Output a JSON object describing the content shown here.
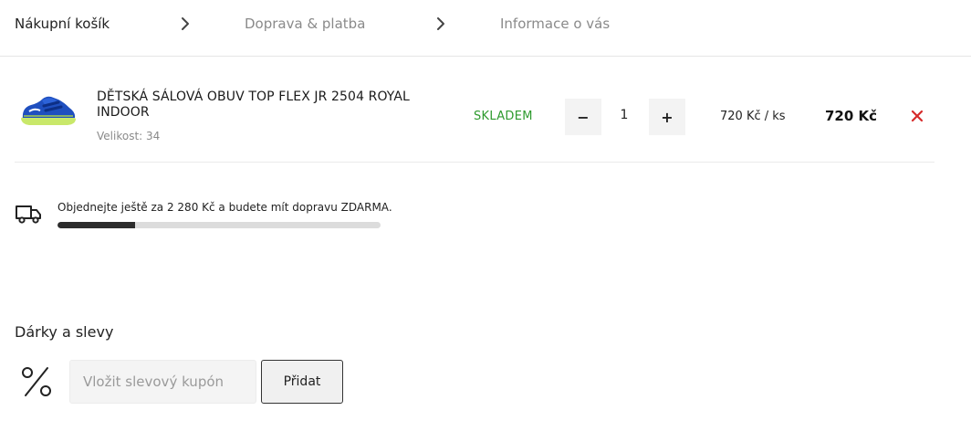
{
  "steps": [
    {
      "label": "Nákupní košík",
      "state": "active"
    },
    {
      "label": "Doprava & platba",
      "state": "inactive"
    },
    {
      "label": "Informace o vás",
      "state": "inactive"
    }
  ],
  "cart": {
    "items": [
      {
        "name": "DĚTSKÁ SÁLOVÁ OBUV TOP FLEX JR 2504 ROYAL INDOOR",
        "size": "Velikost: 34",
        "stock": "SKLADEM",
        "quantity": "1",
        "unit_price": "720 Kč / ks",
        "total": "720 Kč",
        "thumbnail": "shoe-image"
      }
    ],
    "qty_minus_label": "−",
    "qty_plus_label": "+",
    "remove_icon": "close-icon"
  },
  "shipping": {
    "text_before": "Objednejte ještě za ",
    "amount": "2 280 Kč",
    "text_after": " a budete mít dopravu ",
    "free_label": "ZDARMA",
    "text_end": ".",
    "progress": 0.24,
    "icon": "truck-icon"
  },
  "gifts": {
    "title": "Dárky a slevy",
    "coupon_placeholder": "Vložit slevový kupón",
    "coupon_value": "",
    "add_button": "Přidat",
    "icon": "percent-icon"
  },
  "colors": {
    "stock_green": "#2e9a2e",
    "remove_red": "#d62b2b",
    "progress_fill": "#2c2c2c",
    "progress_track": "#dcdcdc"
  }
}
